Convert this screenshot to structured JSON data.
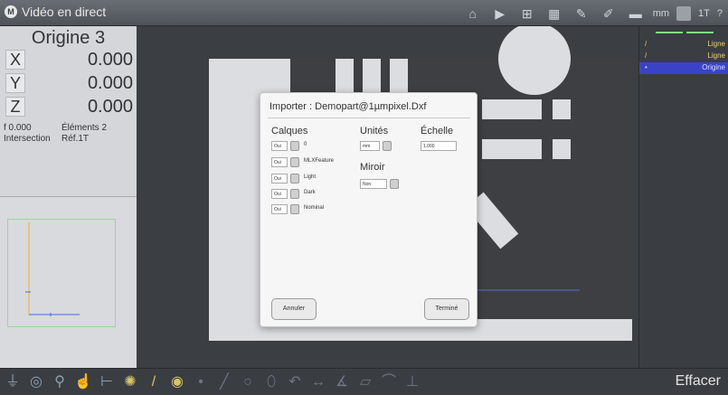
{
  "titlebar": {
    "logo": "M",
    "title": "Vidéo en direct",
    "icons": [
      "home-icon",
      "camera-icon",
      "crosshair-grid-icon",
      "grid-icon",
      "probe-icon",
      "pen-icon",
      "ruler-icon"
    ],
    "unit_label": "mm",
    "lock_icon": "lock-icon",
    "tolerance_label": "1T",
    "help_label": "?"
  },
  "dro": {
    "frame": "Origine 3",
    "axes": [
      {
        "label": "X",
        "value": "0.000"
      },
      {
        "label": "Y",
        "value": "0.000"
      },
      {
        "label": "Z",
        "value": "0.000"
      }
    ],
    "info": {
      "f_value": "f    0.000",
      "elements": "Éléments 2",
      "intersection": "Intersection",
      "ref": "Réf.1T"
    }
  },
  "features": [
    {
      "icon": "/",
      "label": "Ligne"
    },
    {
      "icon": "/",
      "label": "Ligne"
    },
    {
      "icon": "•",
      "label": "Origine"
    }
  ],
  "dialog": {
    "title": "Importer : Demopart@1µmpixel.Dxf",
    "calques_header": "Calques",
    "unites_header": "Unités",
    "echelle_header": "Échelle",
    "miroir_header": "Miroir",
    "layers": [
      {
        "toggle": "Oui",
        "name": "0"
      },
      {
        "toggle": "Oui",
        "name": "MLXFeature"
      },
      {
        "toggle": "Oui",
        "name": "Light"
      },
      {
        "toggle": "Oui",
        "name": "Dark"
      },
      {
        "toggle": "Oui",
        "name": "Nominal"
      }
    ],
    "units_value": "mm",
    "scale_value": "1.000",
    "mirror_value": "Non",
    "cancel_label": "Annuler",
    "done_label": "Terminé"
  },
  "bottombar": {
    "clear_label": "Effacer"
  },
  "colors": {
    "accent_selected": "#3a43c8",
    "feature_text": "#e9d36a"
  }
}
